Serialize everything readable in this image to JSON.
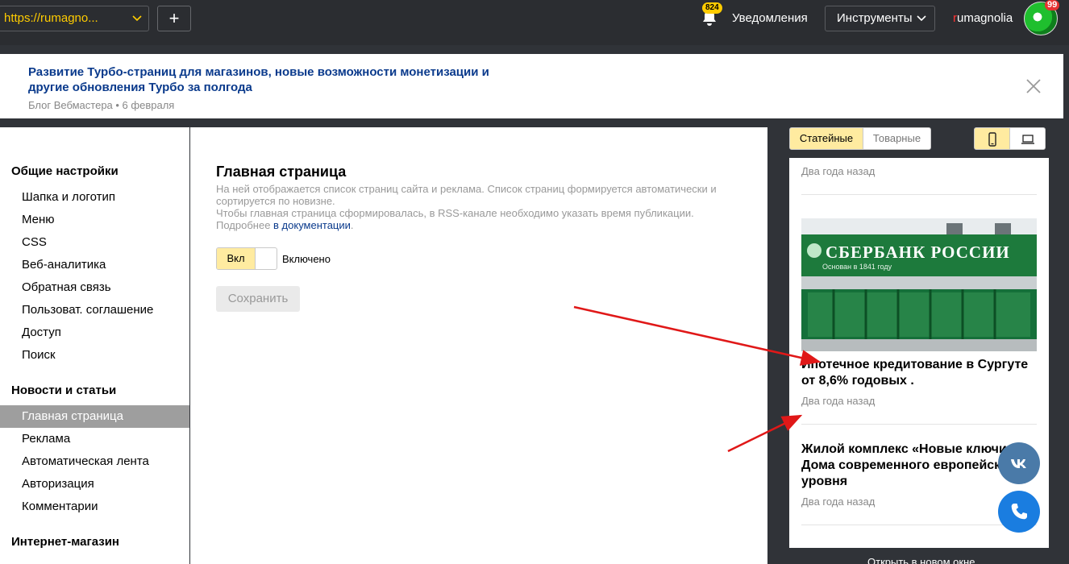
{
  "topbar": {
    "site_url": "https://rumagno...",
    "add_button": "+",
    "notifications_count": "824",
    "notifications_label": "Уведомления",
    "tools_label": "Инструменты",
    "username_first": "r",
    "username_rest": "umagnolia",
    "avatar_badge": "99"
  },
  "announcement": {
    "title": "Развитие Турбо-страниц для магазинов, новые возможности монетизации и другие обновления Турбо за полгода",
    "meta": "Блог Вебмастера • 6 февраля"
  },
  "sidebar": {
    "sections": [
      {
        "title": "Общие настройки",
        "items": [
          "Шапка и логотип",
          "Меню",
          "CSS",
          "Веб-аналитика",
          "Обратная связь",
          "Пользоват. соглашение",
          "Доступ",
          "Поиск"
        ]
      },
      {
        "title": "Новости и статьи",
        "items": [
          "Главная страница",
          "Реклама",
          "Автоматическая лента",
          "Авторизация",
          "Комментарии"
        ]
      },
      {
        "title": "Интернет-магазин",
        "items": []
      }
    ],
    "active_item": "Главная страница"
  },
  "main": {
    "title": "Главная страница",
    "desc_line1": "На ней отображается список страниц сайта и реклама. Список страниц формируется автоматически и сортируется по новизне.",
    "desc_line2": "Чтобы главная страница сформировалась, в RSS-канале необходимо указать время публикации.",
    "desc_more_prefix": "Подробнее ",
    "desc_more_link": "в документации",
    "desc_more_suffix": ".",
    "toggle_on_label": "Вкл",
    "toggle_state": "Включено",
    "save_label": "Сохранить"
  },
  "preview": {
    "tab_article": "Статейные",
    "tab_product": "Товарные",
    "device_mobile_icon": "mobile-icon",
    "device_desktop_icon": "laptop-icon",
    "items": [
      {
        "date": "Два года назад"
      },
      {
        "image_text": "СБЕРБАНК РОССИИ",
        "image_subtext": "Основан в 1841 году",
        "title": "Ипотечное кредитование в Сургуте от 8,6% годовых .",
        "date": "Два года назад"
      },
      {
        "title": "Жилой комплекс «Новые ключи» Дома современного европейского уровня",
        "date": "Два года назад"
      }
    ],
    "open_new_window": "Открыть в новом окне"
  },
  "colors": {
    "accent_yellow": "#ffeba0",
    "topbar_bg": "#2b2d31",
    "link_blue": "#0a3a8c",
    "arrow_red": "#e01818"
  }
}
